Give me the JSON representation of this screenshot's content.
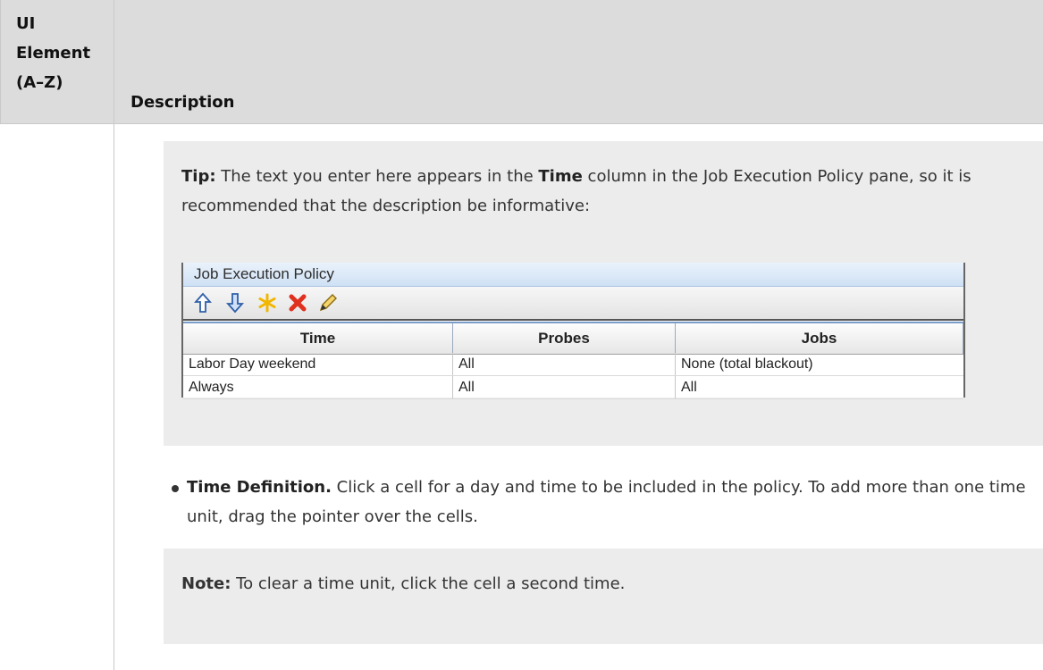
{
  "header": {
    "ui_element_lines": [
      "UI",
      "Element",
      "(A–Z)"
    ],
    "description": "Description"
  },
  "tip": {
    "label": "Tip:",
    "text_before": " The text you enter here appears in the ",
    "bold_word": "Time",
    "text_after": " column in the Job Execution Policy pane, so it is recommended that the description be informative:"
  },
  "embedded_screenshot": {
    "title": "Job Execution Policy",
    "toolbar_icons": [
      "move-up-icon",
      "move-down-icon",
      "new-icon",
      "delete-icon",
      "edit-icon"
    ],
    "columns": [
      "Time",
      "Probes",
      "Jobs"
    ],
    "rows": [
      [
        "Labor Day weekend",
        "All",
        "None (total blackout)"
      ],
      [
        "Always",
        "All",
        "All"
      ]
    ]
  },
  "bullet": {
    "label": "Time Definition.",
    "text": " Click a cell for a day and time to be included in the policy. To add more than one time unit, drag the pointer over the cells."
  },
  "note": {
    "label": "Note:",
    "text": " To clear a time unit, click the cell a second time."
  }
}
